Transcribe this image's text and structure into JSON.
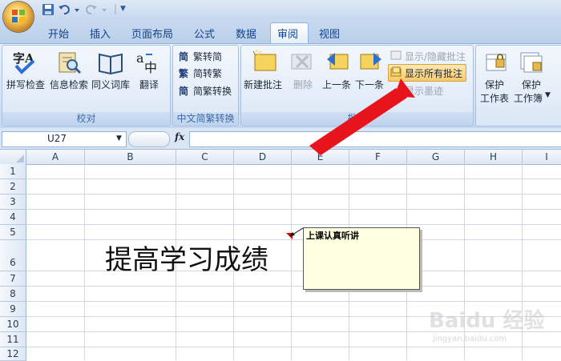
{
  "quick_access": {
    "menu_caret": "▼"
  },
  "tabs": [
    "开始",
    "插入",
    "页面布局",
    "公式",
    "数据",
    "审阅",
    "视图"
  ],
  "active_tab": "审阅",
  "ribbon": {
    "proofing": {
      "label": "校对",
      "spelling": "拼写检查",
      "research": "信息检索",
      "thesaurus": "同义词库",
      "translate": "翻译"
    },
    "chinese_conversion": {
      "label": "中文简繁转换",
      "to_simplified": "繁转简",
      "to_traditional": "简转繁",
      "conversion": "简繁转换"
    },
    "comments": {
      "label": "批注",
      "new_comment": "新建批注",
      "delete": "删除",
      "previous": "上一条",
      "next": "下一条",
      "show_hide": "显示/隐藏批注",
      "show_all": "显示所有批注",
      "show_ink": "显示墨迹"
    },
    "changes": {
      "protect_sheet": [
        "保护",
        "工作表"
      ],
      "protect_workbook": [
        "保护",
        "工作簿"
      ]
    }
  },
  "formula_bar": {
    "name_box": "U27",
    "fx": "fx",
    "formula": ""
  },
  "columns": [
    "A",
    "B",
    "C",
    "D",
    "E",
    "F",
    "G",
    "H",
    "I"
  ],
  "rows": [
    "1",
    "2",
    "3",
    "4",
    "5",
    "6",
    "7",
    "8",
    "9",
    "10",
    "11",
    "12"
  ],
  "cells": {
    "B6": "提高学习成绩"
  },
  "comment": {
    "text": "上课认真听讲"
  },
  "watermark": {
    "main": "Baidu 经验",
    "sub": "jingyan.baidu.com"
  },
  "colors": {
    "arrow": "#e8141b",
    "ribbon": "#d6e3f4",
    "comment_bg": "#ffffe1"
  }
}
